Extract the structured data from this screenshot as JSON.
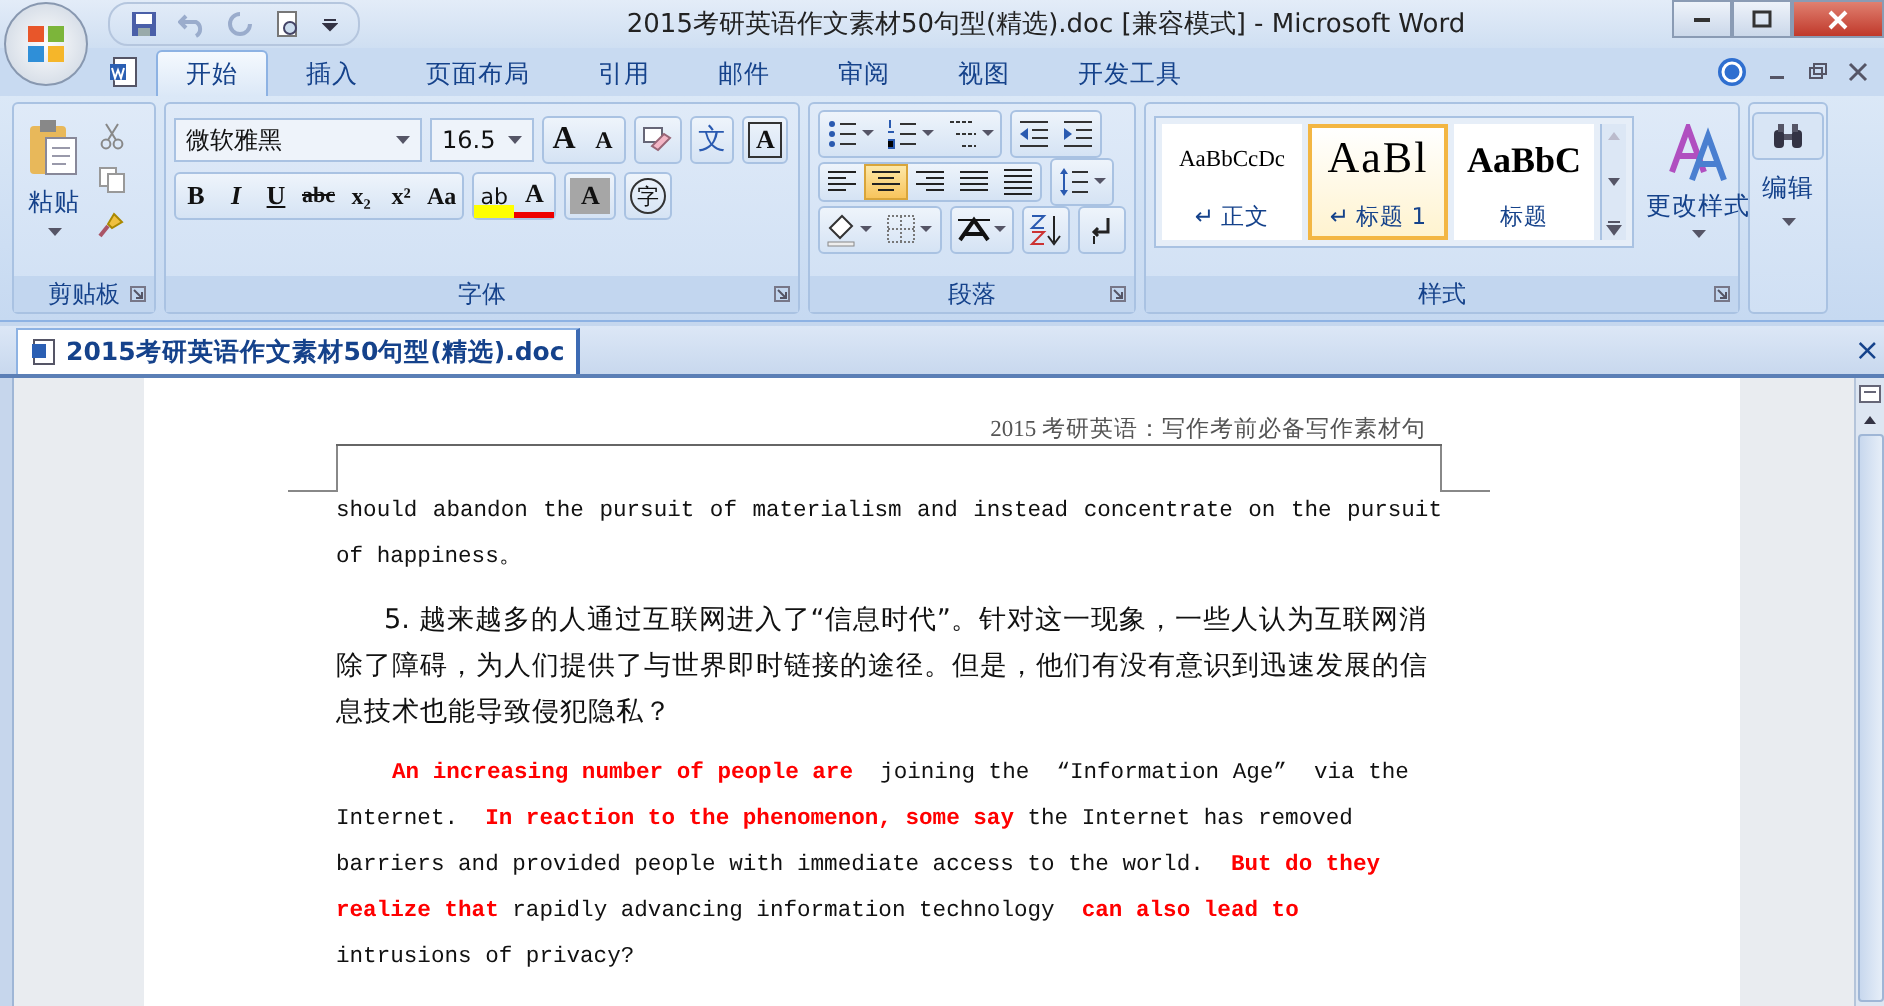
{
  "window": {
    "title": "2015考研英语作文素材50句型(精选).doc [兼容模式] - Microsoft Word"
  },
  "tabs": [
    {
      "label": "开始",
      "selected": true
    },
    {
      "label": "插入",
      "selected": false
    },
    {
      "label": "页面布局",
      "selected": false
    },
    {
      "label": "引用",
      "selected": false
    },
    {
      "label": "邮件",
      "selected": false
    },
    {
      "label": "审阅",
      "selected": false
    },
    {
      "label": "视图",
      "selected": false
    },
    {
      "label": "开发工具",
      "selected": false
    }
  ],
  "ribbon": {
    "clipboard": {
      "label": "剪贴板",
      "paste": "粘贴"
    },
    "font": {
      "label": "字体",
      "name": "微软雅黑",
      "size": "16.5",
      "grow": "A",
      "shrink": "A",
      "phonetic": "文",
      "border": "A",
      "styles": [
        "B",
        "I",
        "U",
        "abc",
        "x₂",
        "x²",
        "Aa"
      ],
      "highlight": "ab",
      "font_color_glyph": "A",
      "shade": "A",
      "enclose": "字"
    },
    "paragraph": {
      "label": "段落",
      "align": [
        {
          "selected": false
        },
        {
          "selected": true
        },
        {
          "selected": false
        },
        {
          "selected": false
        },
        {
          "selected": false
        }
      ]
    },
    "styles": {
      "label": "样式",
      "items": [
        {
          "preview": "AaBbCcDc",
          "name": "↵ 正文",
          "selected": false,
          "kind": "normal"
        },
        {
          "preview": "AaBl",
          "name": "↵ 标题 1",
          "selected": true,
          "kind": "heading1"
        },
        {
          "preview": "AaBbC",
          "name": "标题",
          "selected": false,
          "kind": "title"
        }
      ],
      "change": "更改样式"
    },
    "editing": {
      "label": "编辑"
    }
  },
  "document_tab": {
    "title": "2015考研英语作文素材50句型(精选).doc",
    "close": "×"
  },
  "page": {
    "header": "2015 考研英语：写作考前必备写作素材句",
    "paragraphs": [
      {
        "kind": "english",
        "text": "should abandon the pursuit of materialism and instead concentrate on the pursuit of happiness。"
      },
      {
        "kind": "chinese",
        "text": "5. 越来越多的人通过互联网进入了“信息时代”。针对这一现象，一些人认为互联网消除了障碍，为人们提供了与世界即时链接的途径。但是，他们有没有意识到迅速发展的信息技术也能导致侵犯隐私？"
      },
      {
        "kind": "english-indent",
        "text": "**An increasing number of people are**  joining the  “Information Age”  via the Internet.  **In reaction to the phenomenon, some say** the Internet has removed barriers and provided people with immediate access to the world.  **But do they realize that** rapidly advancing information technology  **can also lead to** intrusions of privacy?"
      }
    ]
  }
}
